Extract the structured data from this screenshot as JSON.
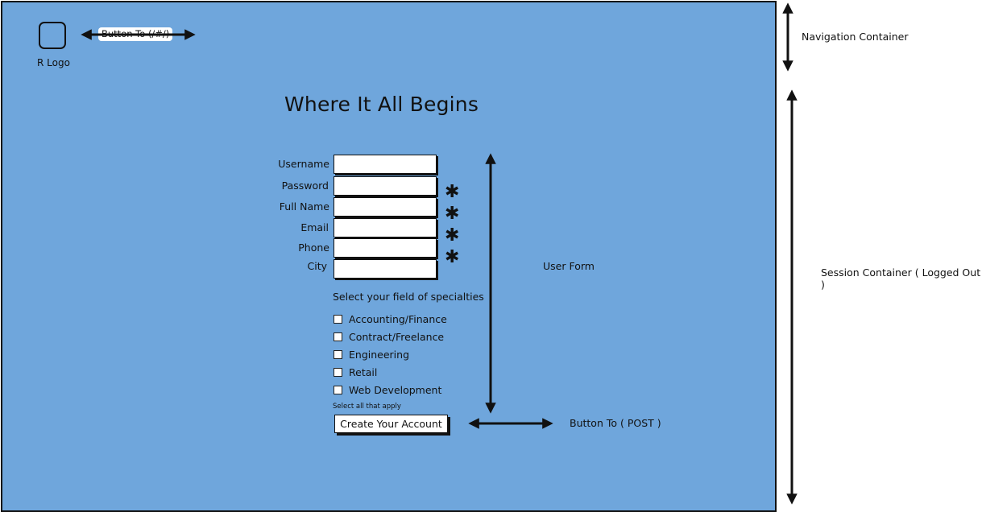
{
  "navigation": {
    "logo_label": "R Logo",
    "nav_button_label": "Button To (/#/)"
  },
  "session": {
    "title": "Where It All Begins",
    "form": {
      "fields": [
        {
          "label": "Username",
          "value": "",
          "required": false
        },
        {
          "label": "Password",
          "value": "",
          "required": true
        },
        {
          "label": "Full Name",
          "value": "",
          "required": true
        },
        {
          "label": "Email",
          "value": "",
          "required": true
        },
        {
          "label": "Phone",
          "value": "",
          "required": true
        },
        {
          "label": "City",
          "value": "",
          "required": false
        }
      ],
      "required_marker": "✱",
      "specialties_heading": "Select your field of specialties",
      "specialties": [
        {
          "label": "Accounting/Finance",
          "checked": false
        },
        {
          "label": "Contract/Freelance",
          "checked": false
        },
        {
          "label": "Engineering",
          "checked": false
        },
        {
          "label": "Retail",
          "checked": false
        },
        {
          "label": "Web Development",
          "checked": false
        }
      ],
      "hint": "Select all that apply",
      "submit_label": "Create Your Account"
    }
  },
  "annotations": {
    "navigation_container": "Navigation Container",
    "session_container": "Session Container ( Logged Out )",
    "user_form": "User Form",
    "post_button": "Button To ( POST )"
  },
  "colors": {
    "canvas_background": "#6fa6dc",
    "outline": "#111111"
  }
}
